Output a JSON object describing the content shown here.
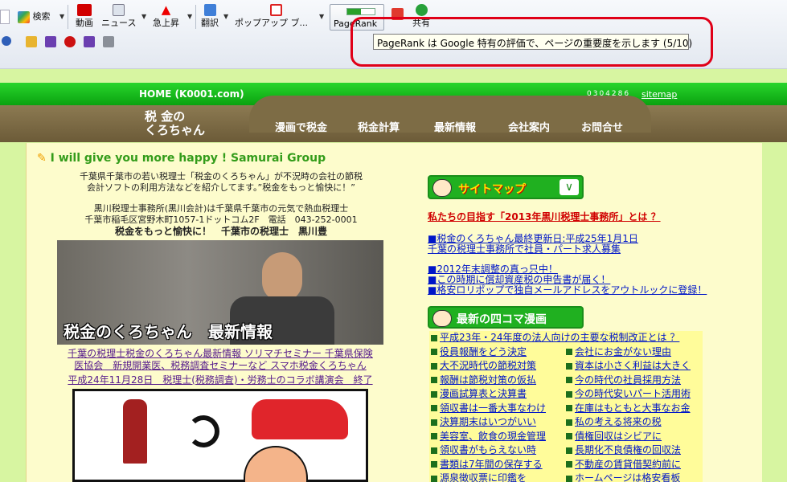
{
  "toolbar": {
    "search_label": "検索",
    "video_label": "動画",
    "news_label": "ニュース",
    "rising_label": "急上昇",
    "translate_label": "翻訳",
    "popup_label": "ポップアップ ブ...",
    "pagerank_label": "PageRank",
    "pagerank_value": 0.5,
    "share_label": "共有",
    "tooltip": "PageRank は Google 特有の評価で、ページの重要度を示します (5/10)"
  },
  "header": {
    "home_label": "HOME (K0001.com)",
    "counter": "0304286",
    "sitemap_label": "sitemap",
    "logo_line1": "税 金の",
    "logo_line2": "くろちゃん",
    "nav": [
      "漫画で税金",
      "税金計算",
      "最新情報",
      "会社案内",
      "お問合せ"
    ]
  },
  "left": {
    "headline": "I will give you more happy ! Samurai Group",
    "intro1": "千葉県千葉市の若い税理士「税金のくろちゃん」が不況時の会社の節税",
    "intro2": "会計ソフトの利用方法などを紹介してます。”税金をもっと愉快に！”",
    "office1": "黒川税理士事務所(黒川会計)は千葉県千葉市の元気で熱血税理士",
    "office2": "千葉市稲毛区宮野木町1057-1ドットコム2F　電話　043-252-0001",
    "tagline": "税金をもっと愉快に！　千葉市の税理士　黒川豊",
    "photo_caption": "税金のくろちゃん　最新情報",
    "link1": "千葉の税理士税金のくろちゃん最新情報 ソリマチセミナー 千葉県保険",
    "link2": "医協会　新規開業医、税務調査セミナーなど スマホ税金くろちゃん",
    "link3": "平成24年11月28日　税理士(税務調査)・労務士のコラボ講演会　終了"
  },
  "right": {
    "sitemap_button": "サイトマップ",
    "red_link": "私たちの目指す「2013年黒川税理士事務所」とは ？",
    "links": [
      "■税金のくろちゃん最終更新日:平成25年1月1日",
      "千葉の税理士事務所で社員・パート求人募集",
      "■2012年末調整の真っ只中！",
      "■この時期に償却資産税の申告書が届く！",
      "■格安ロリポップで独自メールアドレスをアウトルックに登録！"
    ],
    "manga_title": "最新の四コマ漫画",
    "manga_top": "平成23年・24年度の法人向けの主要な税制改正とは ？",
    "manga_left": [
      "役員報酬をどう決定",
      "大不況時代の節税対策",
      "報酬は節税対策の仮払",
      "漫画試算表と決算書",
      "領収書は一番大事なわけ",
      "決算期末はいつがいい",
      "美容室、飲食の現金管理",
      "領収書がもらえない時",
      "書類は7年間の保存する",
      "源泉徴収票に印鑑を"
    ],
    "manga_right": [
      "会社にお金がない理由",
      "資本は小さく利益は大きく",
      "今の時代の社員採用方法",
      "今の時代安いパート活用術",
      "在庫はもともと大事なお金",
      "私の考える将来の税",
      "債権回収はシビアに",
      "長期化不良債権の回収法",
      "不動産の賃貸借契約前に",
      "ホームページは格安看板"
    ]
  }
}
